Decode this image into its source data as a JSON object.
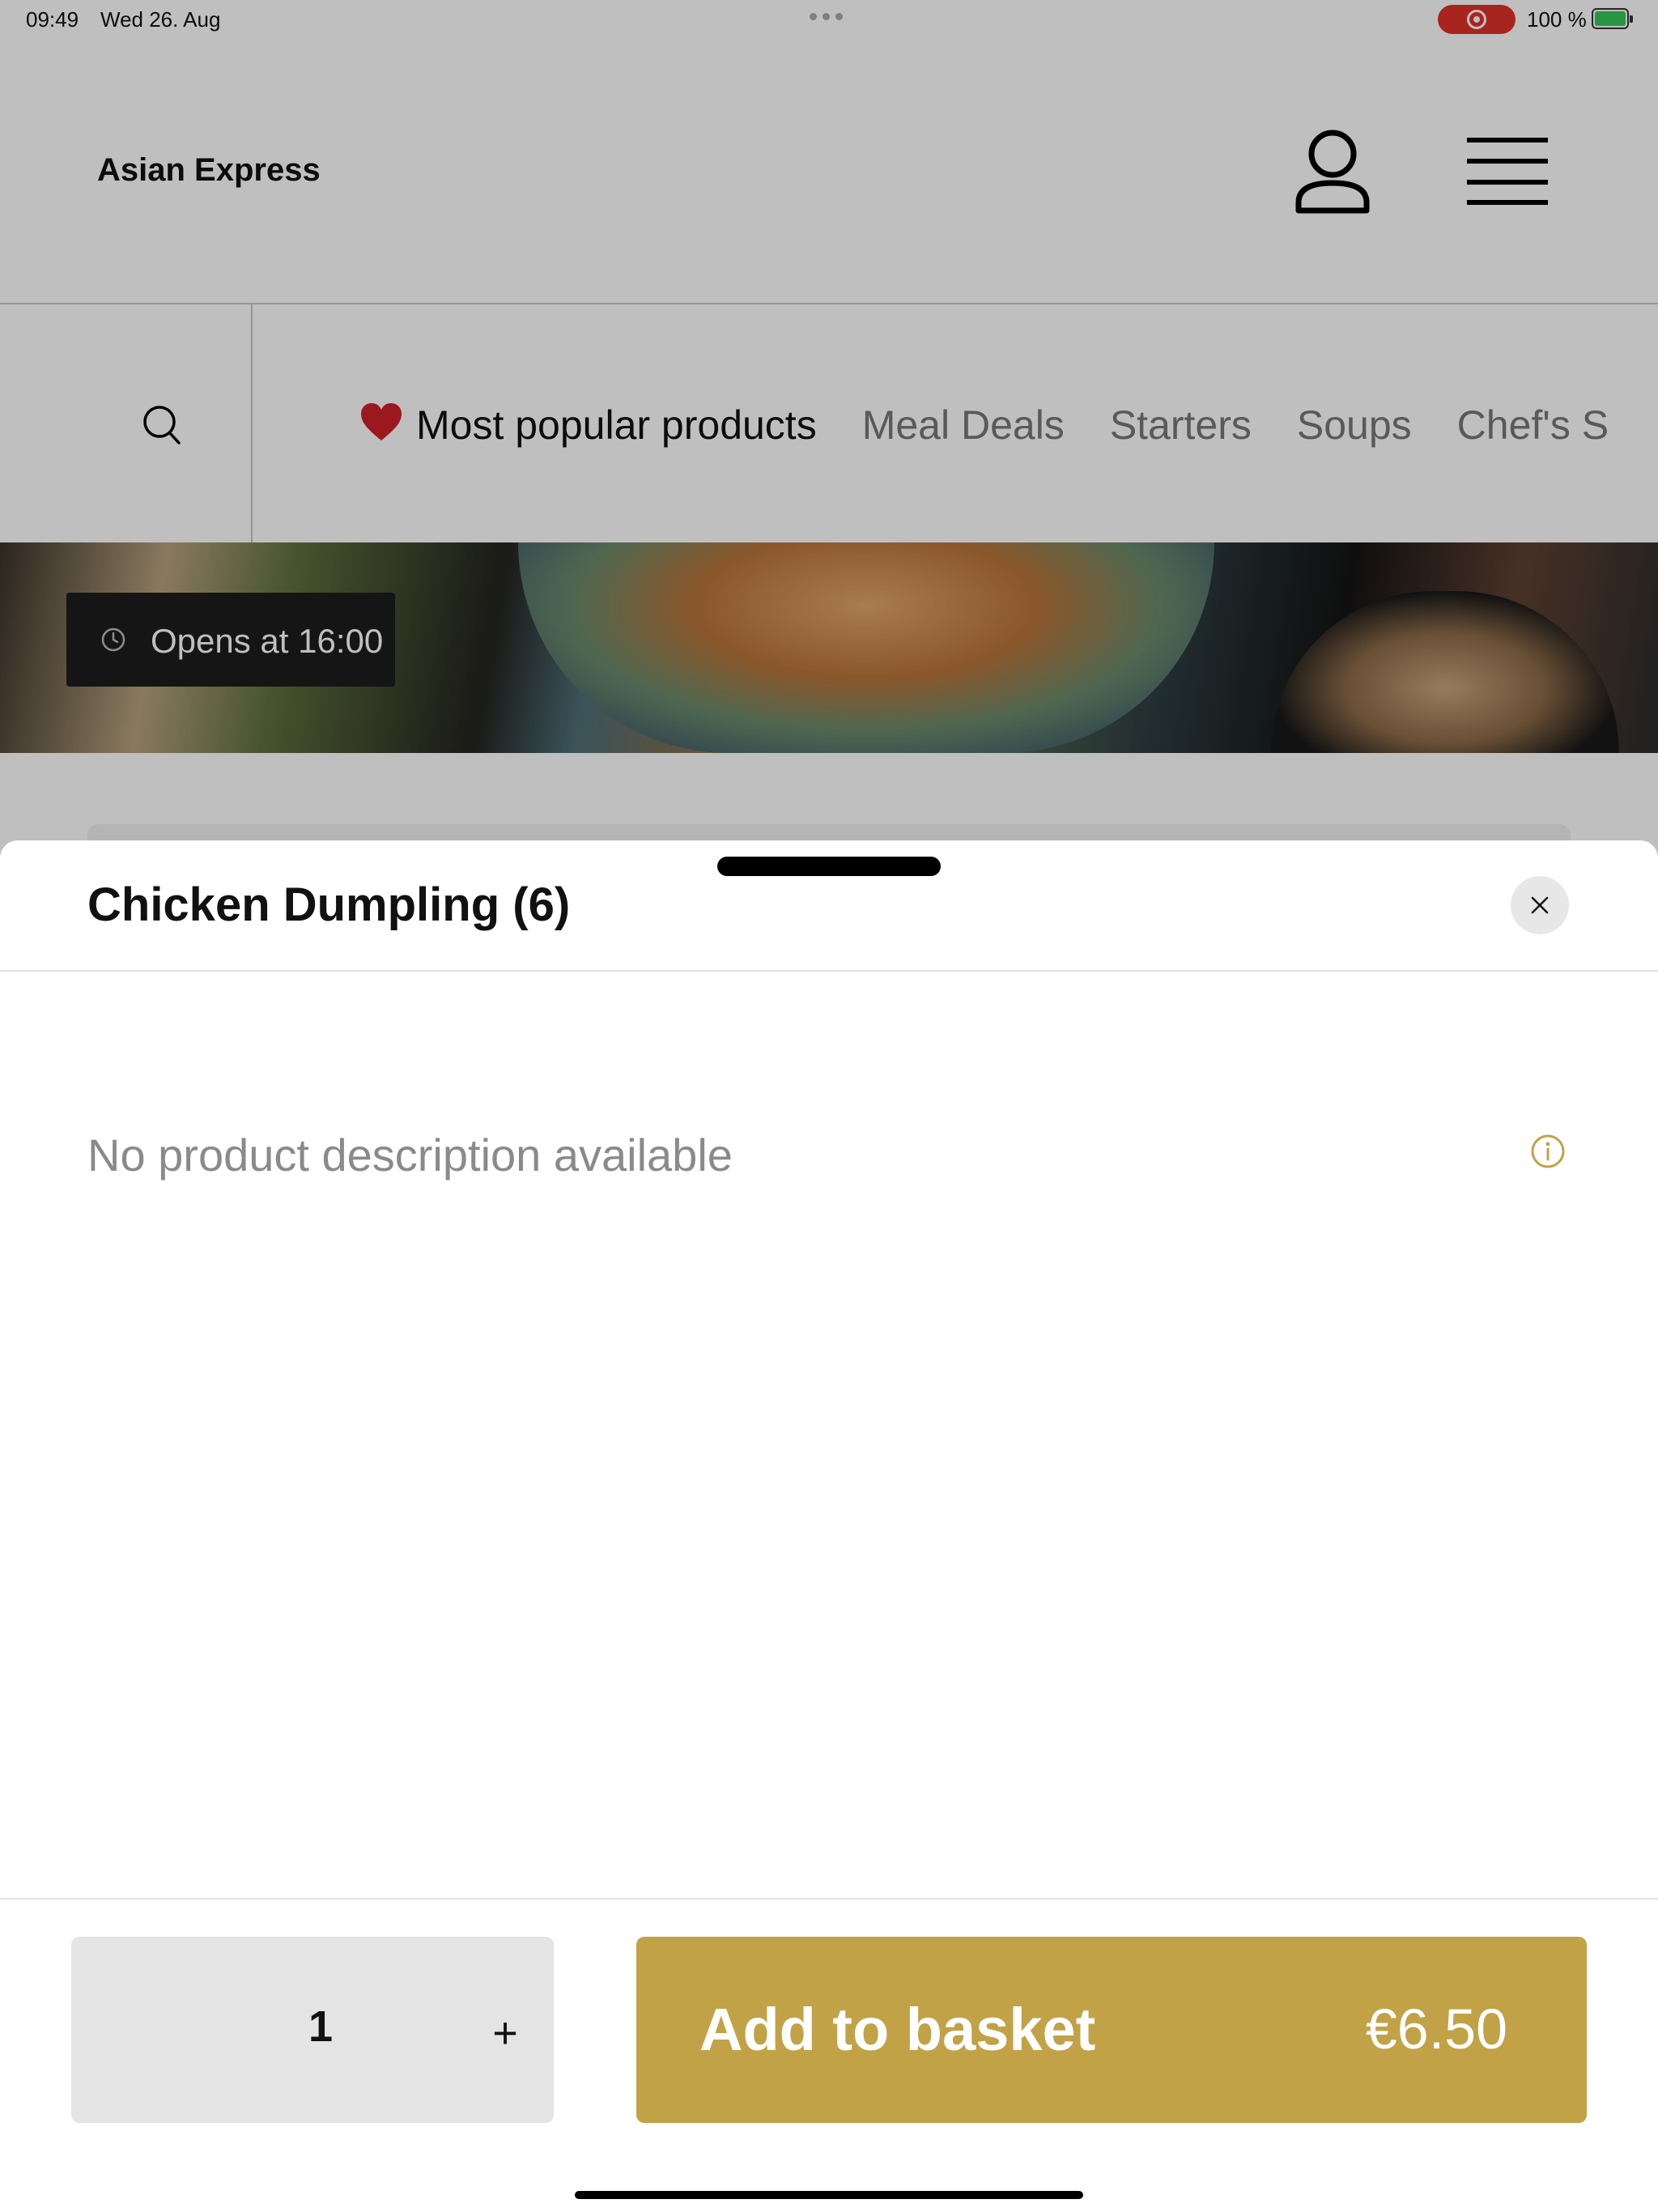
{
  "status_bar": {
    "time": "09:49",
    "date": "Wed 26. Aug",
    "battery": "100 %"
  },
  "header": {
    "brand": "Asian Express",
    "icons": [
      "user-icon",
      "menu-icon"
    ]
  },
  "categories": {
    "items": [
      {
        "label": "Most popular products",
        "icon": "heart-icon",
        "active": true
      },
      {
        "label": "Meal Deals",
        "active": false
      },
      {
        "label": "Starters",
        "active": false
      },
      {
        "label": "Soups",
        "active": false
      },
      {
        "label": "Chef's S",
        "active": false
      }
    ]
  },
  "hero": {
    "opens": "Opens at 16:00"
  },
  "product_sheet": {
    "title": "Chicken Dumpling (6)",
    "description": "No product description available",
    "quantity": "1",
    "plus": "+",
    "add_label": "Add to basket",
    "price": "€6.50"
  },
  "colors": {
    "accent": "#c2a247",
    "heart": "#d0202a",
    "dim_overlay": "rgba(0,0,0,0.25)"
  }
}
